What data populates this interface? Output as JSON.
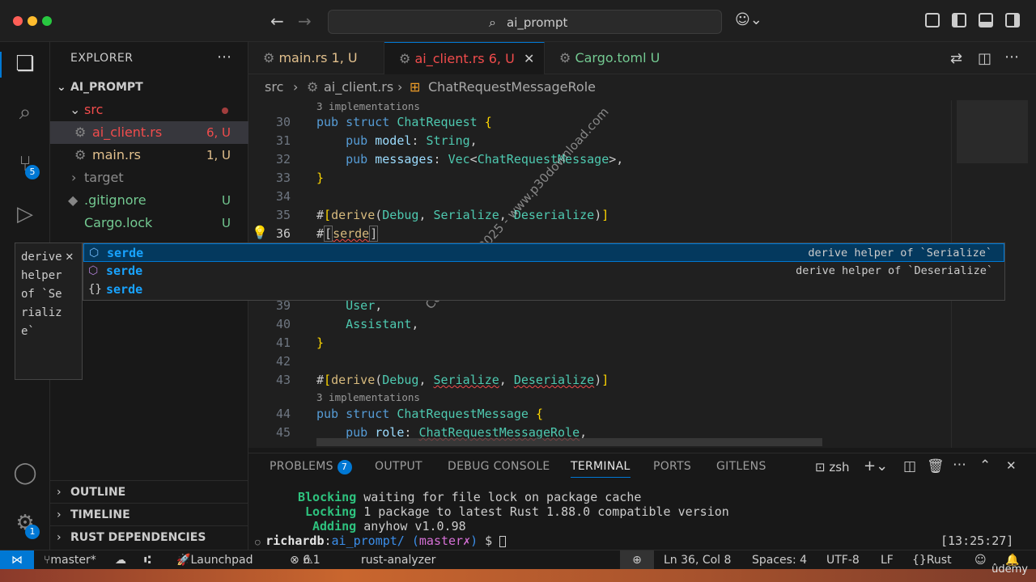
{
  "titlebar": {
    "search_text": "ai_prompt"
  },
  "activity": {
    "source_control_badge": "5",
    "settings_badge": "1"
  },
  "explorer": {
    "title": "EXPLORER",
    "root": "AI_PROMPT",
    "src_folder": "src",
    "files": [
      {
        "name": "ai_client.rs",
        "status": "6, U"
      },
      {
        "name": "main.rs",
        "status": "1, U"
      }
    ],
    "target_folder": "target",
    "gitignore": {
      "name": ".gitignore",
      "status": "U"
    },
    "cargo_lock": {
      "name": "Cargo.lock",
      "status": "U"
    },
    "sections": [
      "OUTLINE",
      "TIMELINE",
      "RUST DEPENDENCIES"
    ]
  },
  "tabs": [
    {
      "name": "main.rs",
      "status": "1, U"
    },
    {
      "name": "ai_client.rs",
      "status": "6, U"
    },
    {
      "name": "Cargo.toml",
      "status": "U"
    }
  ],
  "breadcrumbs": {
    "folder": "src",
    "file": "ai_client.rs",
    "symbol": "ChatRequestMessageRole"
  },
  "editor": {
    "hint_impls": "3 implementations",
    "lines": {
      "l30": "30",
      "l31": "31",
      "l32": "32",
      "l33": "33",
      "l34": "34",
      "l35": "35",
      "l36": "36",
      "l39": "39",
      "l40": "40",
      "l41": "41",
      "l42": "42",
      "l43": "43",
      "l44": "44",
      "l45": "45"
    }
  },
  "suggest": {
    "items": [
      {
        "label": "serde",
        "detail": "derive helper of `Serialize`"
      },
      {
        "label": "serde",
        "detail": "derive helper of `Deserialize`"
      },
      {
        "label": "serde",
        "detail": ""
      }
    ],
    "doc": "derive helper of `Serialize`"
  },
  "watermark": "Copyright © 2025 - www.p30download.com",
  "panel": {
    "tabs": {
      "problems": "PROBLEMS",
      "problems_count": "7",
      "output": "OUTPUT",
      "debug": "DEBUG CONSOLE",
      "terminal": "TERMINAL",
      "ports": "PORTS",
      "gitlens": "GITLENS"
    },
    "shell": "zsh",
    "terminal_lines": [
      {
        "verb": "Blocking",
        "rest": "waiting for file lock on package cache"
      },
      {
        "verb": "Locking",
        "rest": "1 package to latest Rust 1.88.0 compatible version"
      },
      {
        "verb": "Adding",
        "rest": "anyhow v1.0.98"
      }
    ],
    "prompt_user": "richardb",
    "prompt_dir": "ai_prompt/",
    "prompt_branch": "master",
    "prompt_dirty": "✗",
    "prompt_time": "[13:25:27]"
  },
  "status": {
    "branch": "master*",
    "launchpad": "Launchpad",
    "errors": "6",
    "warnings": "1",
    "analyzer": "rust-analyzer",
    "position": "Ln 36, Col 8",
    "spaces": "Spaces: 4",
    "encoding": "UTF-8",
    "eol": "LF",
    "language": "Rust"
  },
  "brand": "ûdemy"
}
